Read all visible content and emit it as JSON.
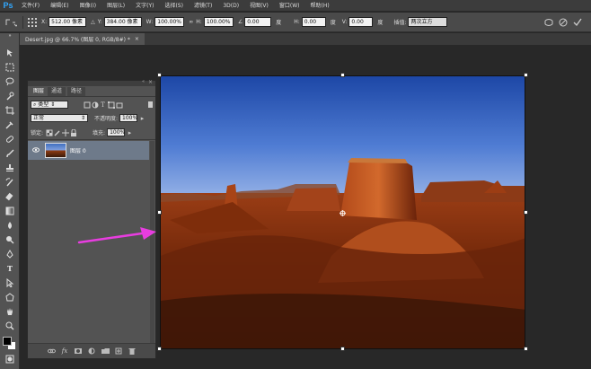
{
  "app": {
    "logo": "Ps"
  },
  "menu": [
    "文件(F)",
    "编辑(E)",
    "图像(I)",
    "图层(L)",
    "文字(Y)",
    "选择(S)",
    "滤镜(T)",
    "3D(D)",
    "视图(V)",
    "窗口(W)",
    "帮助(H)"
  ],
  "options": {
    "x_label": "X:",
    "x_value": "512.00 像素",
    "y_label": "Y:",
    "y_value": "384.00 像素",
    "w_label": "W:",
    "w_value": "100.00%",
    "h_label": "H:",
    "h_value": "100.00%",
    "angle_value": "0.00",
    "angle_unit": "度",
    "hskew_label": "H:",
    "hskew_value": "0.00",
    "hskew_unit": "度",
    "vskew_label": "V:",
    "vskew_value": "0.00",
    "vskew_unit": "度",
    "interp_label": "插值:",
    "interp_value": "两次立方"
  },
  "document_tab": {
    "title": "Desert.jpg @ 66.7% (图层 0, RGB/8#) *",
    "close": "×"
  },
  "layers_panel": {
    "tabs": [
      "图层",
      "通道",
      "路径"
    ],
    "kind_filter": "类型",
    "blend_mode": "正常",
    "opacity_label": "不透明度:",
    "opacity_value": "100%",
    "lock_label": "锁定:",
    "fill_label": "填充:",
    "fill_value": "100%",
    "layer_name": "图层 0"
  },
  "colors": {
    "accent": "#31a8ff",
    "arrow": "#e83de0",
    "panel": "#535353",
    "canvas_bg": "#282828"
  }
}
